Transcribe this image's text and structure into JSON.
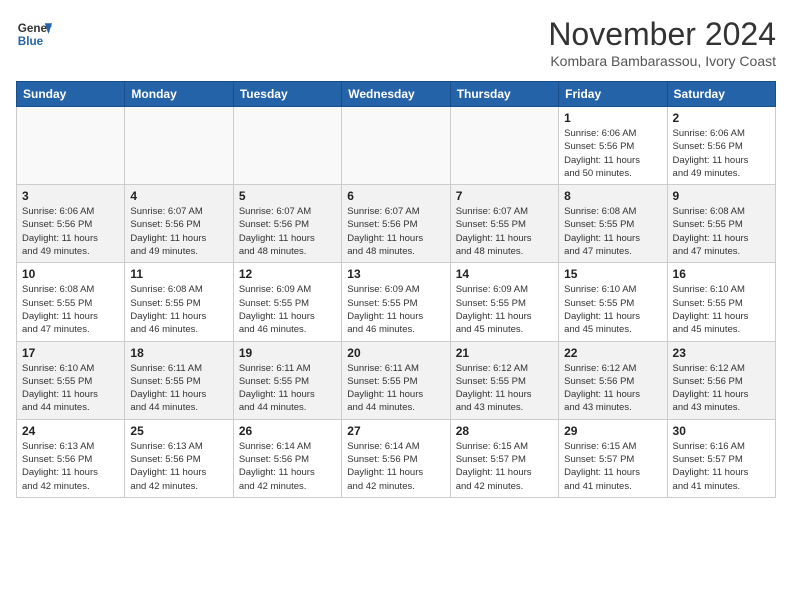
{
  "header": {
    "logo_line1": "General",
    "logo_line2": "Blue",
    "month": "November 2024",
    "location": "Kombara Bambarassou, Ivory Coast"
  },
  "weekdays": [
    "Sunday",
    "Monday",
    "Tuesday",
    "Wednesday",
    "Thursday",
    "Friday",
    "Saturday"
  ],
  "weeks": [
    [
      {
        "day": "",
        "info": ""
      },
      {
        "day": "",
        "info": ""
      },
      {
        "day": "",
        "info": ""
      },
      {
        "day": "",
        "info": ""
      },
      {
        "day": "",
        "info": ""
      },
      {
        "day": "1",
        "info": "Sunrise: 6:06 AM\nSunset: 5:56 PM\nDaylight: 11 hours\nand 50 minutes."
      },
      {
        "day": "2",
        "info": "Sunrise: 6:06 AM\nSunset: 5:56 PM\nDaylight: 11 hours\nand 49 minutes."
      }
    ],
    [
      {
        "day": "3",
        "info": "Sunrise: 6:06 AM\nSunset: 5:56 PM\nDaylight: 11 hours\nand 49 minutes."
      },
      {
        "day": "4",
        "info": "Sunrise: 6:07 AM\nSunset: 5:56 PM\nDaylight: 11 hours\nand 49 minutes."
      },
      {
        "day": "5",
        "info": "Sunrise: 6:07 AM\nSunset: 5:56 PM\nDaylight: 11 hours\nand 48 minutes."
      },
      {
        "day": "6",
        "info": "Sunrise: 6:07 AM\nSunset: 5:56 PM\nDaylight: 11 hours\nand 48 minutes."
      },
      {
        "day": "7",
        "info": "Sunrise: 6:07 AM\nSunset: 5:55 PM\nDaylight: 11 hours\nand 48 minutes."
      },
      {
        "day": "8",
        "info": "Sunrise: 6:08 AM\nSunset: 5:55 PM\nDaylight: 11 hours\nand 47 minutes."
      },
      {
        "day": "9",
        "info": "Sunrise: 6:08 AM\nSunset: 5:55 PM\nDaylight: 11 hours\nand 47 minutes."
      }
    ],
    [
      {
        "day": "10",
        "info": "Sunrise: 6:08 AM\nSunset: 5:55 PM\nDaylight: 11 hours\nand 47 minutes."
      },
      {
        "day": "11",
        "info": "Sunrise: 6:08 AM\nSunset: 5:55 PM\nDaylight: 11 hours\nand 46 minutes."
      },
      {
        "day": "12",
        "info": "Sunrise: 6:09 AM\nSunset: 5:55 PM\nDaylight: 11 hours\nand 46 minutes."
      },
      {
        "day": "13",
        "info": "Sunrise: 6:09 AM\nSunset: 5:55 PM\nDaylight: 11 hours\nand 46 minutes."
      },
      {
        "day": "14",
        "info": "Sunrise: 6:09 AM\nSunset: 5:55 PM\nDaylight: 11 hours\nand 45 minutes."
      },
      {
        "day": "15",
        "info": "Sunrise: 6:10 AM\nSunset: 5:55 PM\nDaylight: 11 hours\nand 45 minutes."
      },
      {
        "day": "16",
        "info": "Sunrise: 6:10 AM\nSunset: 5:55 PM\nDaylight: 11 hours\nand 45 minutes."
      }
    ],
    [
      {
        "day": "17",
        "info": "Sunrise: 6:10 AM\nSunset: 5:55 PM\nDaylight: 11 hours\nand 44 minutes."
      },
      {
        "day": "18",
        "info": "Sunrise: 6:11 AM\nSunset: 5:55 PM\nDaylight: 11 hours\nand 44 minutes."
      },
      {
        "day": "19",
        "info": "Sunrise: 6:11 AM\nSunset: 5:55 PM\nDaylight: 11 hours\nand 44 minutes."
      },
      {
        "day": "20",
        "info": "Sunrise: 6:11 AM\nSunset: 5:55 PM\nDaylight: 11 hours\nand 44 minutes."
      },
      {
        "day": "21",
        "info": "Sunrise: 6:12 AM\nSunset: 5:55 PM\nDaylight: 11 hours\nand 43 minutes."
      },
      {
        "day": "22",
        "info": "Sunrise: 6:12 AM\nSunset: 5:56 PM\nDaylight: 11 hours\nand 43 minutes."
      },
      {
        "day": "23",
        "info": "Sunrise: 6:12 AM\nSunset: 5:56 PM\nDaylight: 11 hours\nand 43 minutes."
      }
    ],
    [
      {
        "day": "24",
        "info": "Sunrise: 6:13 AM\nSunset: 5:56 PM\nDaylight: 11 hours\nand 42 minutes."
      },
      {
        "day": "25",
        "info": "Sunrise: 6:13 AM\nSunset: 5:56 PM\nDaylight: 11 hours\nand 42 minutes."
      },
      {
        "day": "26",
        "info": "Sunrise: 6:14 AM\nSunset: 5:56 PM\nDaylight: 11 hours\nand 42 minutes."
      },
      {
        "day": "27",
        "info": "Sunrise: 6:14 AM\nSunset: 5:56 PM\nDaylight: 11 hours\nand 42 minutes."
      },
      {
        "day": "28",
        "info": "Sunrise: 6:15 AM\nSunset: 5:57 PM\nDaylight: 11 hours\nand 42 minutes."
      },
      {
        "day": "29",
        "info": "Sunrise: 6:15 AM\nSunset: 5:57 PM\nDaylight: 11 hours\nand 41 minutes."
      },
      {
        "day": "30",
        "info": "Sunrise: 6:16 AM\nSunset: 5:57 PM\nDaylight: 11 hours\nand 41 minutes."
      }
    ]
  ]
}
